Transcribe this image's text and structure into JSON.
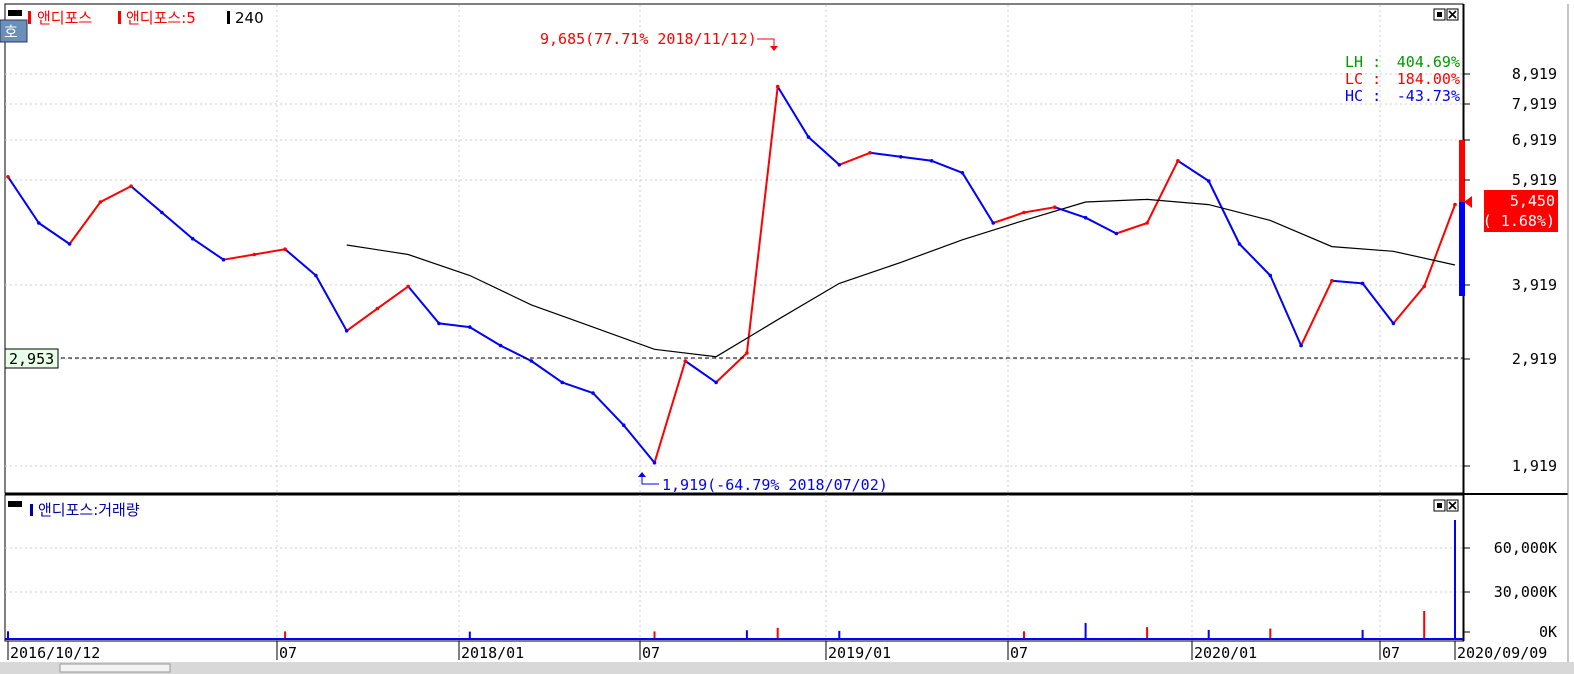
{
  "legend_price": {
    "series1": "앤디포스",
    "series2": "앤디포스:5",
    "series3": "240"
  },
  "legend_volume": {
    "series1": "앤디포스:거래량"
  },
  "mode_button": "호",
  "stats": {
    "lh_label": "LH :",
    "lh_value": "404.69%",
    "lc_label": "LC :",
    "lc_value": "184.00%",
    "hc_label": "HC :",
    "hc_value": "-43.73%"
  },
  "high_annotation": "9,685(77.71% 2018/11/12)",
  "low_annotation": "1,919(-64.79% 2018/07/02)",
  "reference_line_value": "2,953",
  "current_price": {
    "value": "5,450",
    "change": "( 1.68%)"
  },
  "colors": {
    "up": "#ff0000",
    "down": "#0000ff",
    "ma": "#000000",
    "lh": "#009900",
    "lc": "#ff0000",
    "hc": "#0000ff"
  },
  "chart_data": {
    "type": "line",
    "price_axis_ticks": [
      "8,919",
      "7,919",
      "6,919",
      "5,919",
      "5,450",
      "3,919",
      "2,919",
      "1,919"
    ],
    "volume_axis_ticks": [
      "60,000K",
      "30,000K",
      "0K"
    ],
    "x_axis_ticks": [
      "2016/10/12",
      "07",
      "2018/01",
      "07",
      "2019/01",
      "07",
      "2020/01",
      "07",
      "2020/09/09"
    ],
    "ylim": [
      1800,
      10000
    ],
    "series": [
      {
        "name": "앤디포스",
        "x": [
          "2016/10",
          "2016/11",
          "2016/12",
          "2017/01",
          "2017/02",
          "2017/03",
          "2017/04",
          "2017/05",
          "2017/06",
          "2017/07",
          "2017/08",
          "2017/09",
          "2017/10",
          "2017/11",
          "2017/12",
          "2018/01",
          "2018/02",
          "2018/03",
          "2018/04",
          "2018/05",
          "2018/06",
          "2018/07",
          "2018/08",
          "2018/09",
          "2018/10",
          "2018/11",
          "2018/12",
          "2019/01",
          "2019/02",
          "2019/03",
          "2019/04",
          "2019/05",
          "2019/06",
          "2019/07",
          "2019/08",
          "2019/09",
          "2019/10",
          "2019/11",
          "2019/12",
          "2020/01",
          "2020/02",
          "2020/03",
          "2020/04",
          "2020/05",
          "2020/06",
          "2020/07",
          "2020/08",
          "2020/09"
        ],
        "values": [
          6000,
          5100,
          4700,
          5500,
          5800,
          5300,
          4800,
          4400,
          4500,
          4600,
          4100,
          3300,
          3600,
          3900,
          3400,
          3350,
          3100,
          2900,
          2700,
          2600,
          2300,
          1950,
          2900,
          2700,
          3000,
          8500,
          7000,
          6300,
          6600,
          6500,
          6400,
          6100,
          5100,
          5300,
          5400,
          5200,
          4900,
          5100,
          6400,
          5900,
          4700,
          4100,
          3100,
          4000,
          3950,
          3400,
          3900,
          5450
        ]
      },
      {
        "name": "240",
        "x": [
          "2017/09",
          "2017/11",
          "2018/01",
          "2018/03",
          "2018/05",
          "2018/07",
          "2018/09",
          "2018/11",
          "2019/01",
          "2019/03",
          "2019/05",
          "2019/07",
          "2019/09",
          "2019/11",
          "2020/01",
          "2020/03",
          "2020/05",
          "2020/07",
          "2020/09"
        ],
        "values": [
          4680,
          4500,
          4100,
          3650,
          3350,
          3050,
          2950,
          3450,
          3950,
          4350,
          4780,
          5150,
          5500,
          5550,
          5450,
          5150,
          4650,
          4560,
          4300
        ]
      }
    ],
    "volume": {
      "name": "앤디포스:거래량",
      "x": [
        "2016/10",
        "2017/07",
        "2018/01",
        "2018/07",
        "2018/10",
        "2018/11",
        "2019/01",
        "2019/07",
        "2019/09",
        "2019/11",
        "2020/01",
        "2020/03",
        "2020/06",
        "2020/08",
        "2020/09"
      ],
      "values": [
        500,
        400,
        300,
        400,
        1200,
        3000,
        800,
        500,
        6500,
        3500,
        1500,
        2500,
        1500,
        15000,
        80000
      ]
    }
  }
}
